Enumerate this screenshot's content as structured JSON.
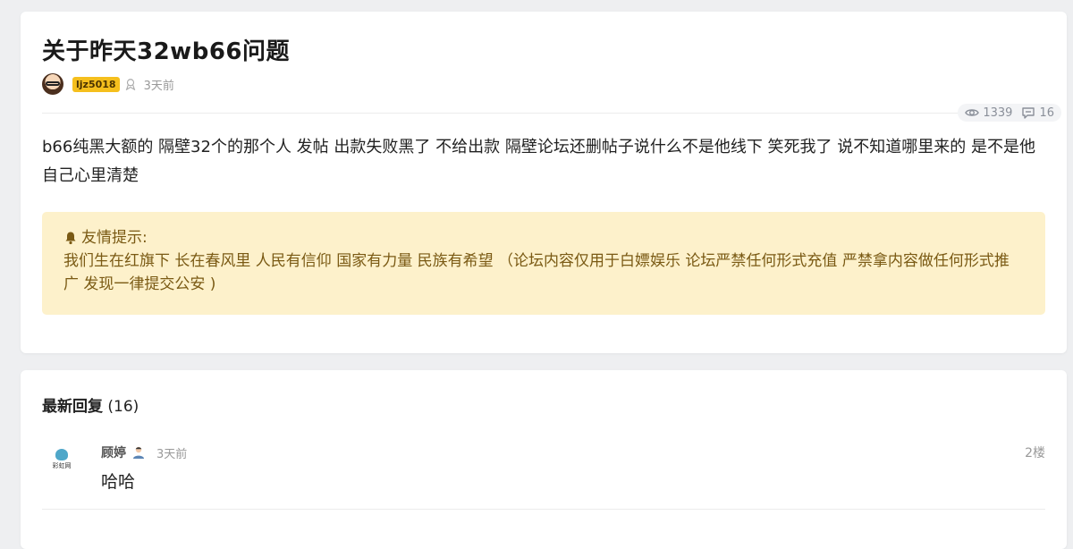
{
  "post": {
    "title": "关于昨天32wb66问题",
    "author": "ljz5018",
    "time": "3天前",
    "views": "1339",
    "comments": "16",
    "content": "b66纯黑大额的 隔壁32个的那个人 发帖 出款失败黑了 不给出款 隔壁论坛还删帖子说什么不是他线下 笑死我了 说不知道哪里来的 是不是他自己心里清楚",
    "notice_title": "友情提示:",
    "notice_text": "我们生在红旗下 长在春风里 人民有信仰 国家有力量 民族有希望 （论坛内容仅用于白嫖娱乐 论坛严禁任何形式充值 严禁拿内容做任何形式推广 发现一律提交公安 )"
  },
  "replies": {
    "heading": "最新回复",
    "count": "(16)",
    "items": [
      {
        "avatar_text": "彩虹网",
        "name": "顾婷",
        "time": "3天前",
        "floor": "2楼",
        "text": "哈哈"
      }
    ]
  },
  "colors": {
    "badge": "#f5bf1d",
    "notice_bg": "#fdf1cb",
    "notice_text": "#7a5a14"
  },
  "icons": [
    "eye-icon",
    "comment-icon",
    "bell-icon",
    "medal-icon",
    "user-icon"
  ]
}
